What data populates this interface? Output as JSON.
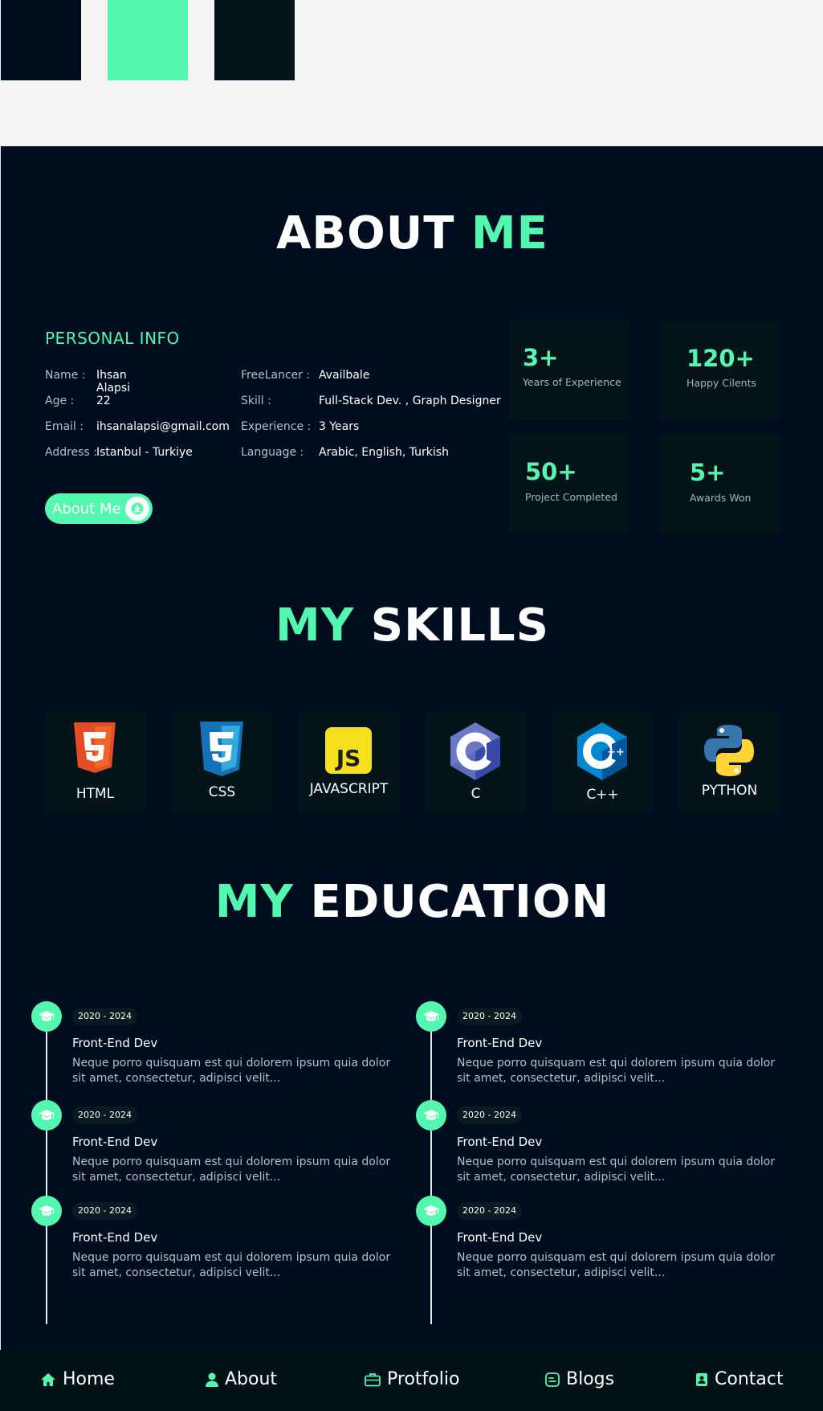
{
  "swatches": [
    {
      "name": "navy",
      "color": "#000d1f"
    },
    {
      "name": "mint",
      "color": "#53f7b0"
    },
    {
      "name": "dark-teal",
      "color": "#041418"
    }
  ],
  "about": {
    "title_a": "ABOUT",
    "title_b": "ME",
    "personal_heading": "PERSONAL INFO",
    "left_info": [
      {
        "label": "Name :",
        "value": "Ihsan Alapsi"
      },
      {
        "label": "Age :",
        "value": "22"
      },
      {
        "label": "Email :",
        "value": "ihsanalapsi@gmail.com"
      },
      {
        "label": "Address :",
        "value": "Istanbul - Turkiye"
      }
    ],
    "right_info": [
      {
        "label": "FreeLancer :",
        "value": "Availbale"
      },
      {
        "label": "Skill :",
        "value": "Full-Stack Dev. , Graph Designer"
      },
      {
        "label": "Experience :",
        "value": "3 Years"
      },
      {
        "label": "Language :",
        "value": "Arabic, English, Turkish"
      }
    ],
    "button_label": "About Me",
    "button_icon": "download-icon",
    "stats": [
      {
        "num": "3+",
        "caption": "Years of Experience"
      },
      {
        "num": "120+",
        "caption": "Happy Cilents"
      },
      {
        "num": "50+",
        "caption": "Project Completed"
      },
      {
        "num": "5+",
        "caption": "Awards Won"
      }
    ]
  },
  "skills": {
    "title_a": "MY",
    "title_b": "SKILLS",
    "items": [
      {
        "label": "HTML",
        "icon": "html5-icon"
      },
      {
        "label": "CSS",
        "icon": "css3-icon"
      },
      {
        "label": "JAVASCRIPT",
        "icon": "javascript-icon"
      },
      {
        "label": "C",
        "icon": "c-language-icon"
      },
      {
        "label": "C++",
        "icon": "cpp-language-icon"
      },
      {
        "label": "PYTHON",
        "icon": "python-icon"
      }
    ]
  },
  "education": {
    "title_a": "MY",
    "title_b": "EDUCATION",
    "icon": "graduation-cap-icon",
    "items": [
      {
        "date": "2020 - 2024",
        "title": "Front-End Dev",
        "desc": "Neque porro quisquam est qui dolorem ipsum quia dolor sit amet, consectetur, adipisci velit..."
      },
      {
        "date": "2020 - 2024",
        "title": "Front-End Dev",
        "desc": "Neque porro quisquam est qui dolorem ipsum quia dolor sit amet, consectetur, adipisci velit..."
      },
      {
        "date": "2020 - 2024",
        "title": "Front-End Dev",
        "desc": "Neque porro quisquam est qui dolorem ipsum quia dolor sit amet, consectetur, adipisci velit..."
      },
      {
        "date": "2020 - 2024",
        "title": "Front-End Dev",
        "desc": "Neque porro quisquam est qui dolorem ipsum quia dolor sit amet, consectetur, adipisci velit..."
      },
      {
        "date": "2020 - 2024",
        "title": "Front-End Dev",
        "desc": "Neque porro quisquam est qui dolorem ipsum quia dolor sit amet, consectetur, adipisci velit..."
      },
      {
        "date": "2020 - 2024",
        "title": "Front-End Dev",
        "desc": "Neque porro quisquam est qui dolorem ipsum quia dolor sit amet, consectetur, adipisci velit..."
      }
    ]
  },
  "nav": [
    {
      "label": "Home",
      "icon": "home-icon"
    },
    {
      "label": "About",
      "icon": "user-icon"
    },
    {
      "label": "Protfolio",
      "icon": "briefcase-icon"
    },
    {
      "label": "Blogs",
      "icon": "blog-icon"
    },
    {
      "label": "Contact",
      "icon": "contact-icon"
    }
  ]
}
